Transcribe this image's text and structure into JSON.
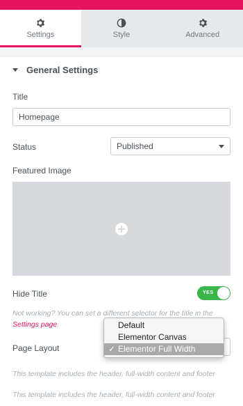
{
  "tabs": [
    {
      "label": "Settings",
      "icon": "gear-icon",
      "active": true
    },
    {
      "label": "Style",
      "icon": "contrast-icon",
      "active": false
    },
    {
      "label": "Advanced",
      "icon": "gear-icon",
      "active": false
    }
  ],
  "section": {
    "title": "General Settings"
  },
  "fields": {
    "title_label": "Title",
    "title_value": "Homepage",
    "status_label": "Status",
    "status_value": "Published",
    "featured_image_label": "Featured Image",
    "hide_title_label": "Hide Title",
    "hide_title_toggle": "YES",
    "hide_title_on": true,
    "page_layout_label": "Page Layout"
  },
  "notes": {
    "not_working_text": "Not working? You can set a different selector for the title in the",
    "settings_link": "Settings page",
    "template_desc_1": "This template includes the header, full-width content and footer",
    "template_desc_2": "This template includes the header, full-width content and footer"
  },
  "layout_dropdown": {
    "options": [
      "Default",
      "Elementor Canvas",
      "Elementor Full Width"
    ],
    "selected": "Elementor Full Width"
  },
  "colors": {
    "accent": "#e6135e",
    "toggle_on": "#39b54a",
    "text": "#495157"
  }
}
